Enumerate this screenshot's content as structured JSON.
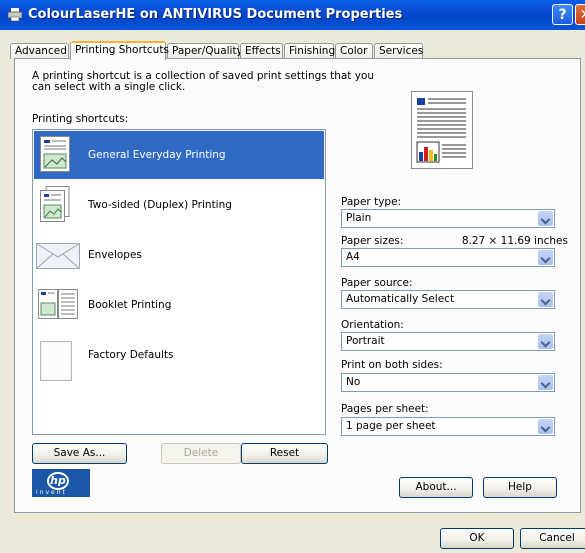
{
  "window": {
    "title": "ColourLaserHE on ANTIVIRUS Document Properties",
    "help_label": "?",
    "close_label": "✕"
  },
  "tabs": [
    {
      "label": "Advanced",
      "active": false
    },
    {
      "label": "Printing Shortcuts",
      "active": true
    },
    {
      "label": "Paper/Quality",
      "active": false
    },
    {
      "label": "Effects",
      "active": false
    },
    {
      "label": "Finishing",
      "active": false
    },
    {
      "label": "Color",
      "active": false
    },
    {
      "label": "Services",
      "active": false
    }
  ],
  "intro_text": "A printing shortcut is a collection of saved print settings that you can select with a single click.",
  "shortcuts_label": "Printing shortcuts:",
  "shortcuts": [
    {
      "label": "General Everyday Printing",
      "icon": "general-printing-icon",
      "selected": true
    },
    {
      "label": "Two-sided (Duplex) Printing",
      "icon": "duplex-printing-icon",
      "selected": false
    },
    {
      "label": "Envelopes",
      "icon": "envelope-icon",
      "selected": false
    },
    {
      "label": "Booklet Printing",
      "icon": "booklet-icon",
      "selected": false
    },
    {
      "label": "Factory Defaults",
      "icon": "factory-defaults-icon",
      "selected": false
    }
  ],
  "list_buttons": {
    "save_as": "Save As...",
    "delete": "Delete",
    "reset": "Reset"
  },
  "fields": {
    "paper_type": {
      "label": "Paper type:",
      "value": "Plain"
    },
    "paper_sizes": {
      "label": "Paper sizes:",
      "dimensions": "8.27 × 11.69 inches",
      "value": "A4"
    },
    "paper_source": {
      "label": "Paper source:",
      "value": "Automatically Select"
    },
    "orientation": {
      "label": "Orientation:",
      "value": "Portrait"
    },
    "print_both_sides": {
      "label": "Print on both sides:",
      "value": "No"
    },
    "pages_per_sheet": {
      "label": "Pages per sheet:",
      "value": "1 page per sheet"
    }
  },
  "logo": {
    "brand": "hp",
    "tagline": "invent"
  },
  "panel_buttons": {
    "about": "About...",
    "help": "Help"
  },
  "dialog_buttons": {
    "ok": "OK",
    "cancel": "Cancel"
  },
  "colors": {
    "selection": "#316ac5",
    "titlebar": "#0a4bd0",
    "dialog_bg": "#ece9d8"
  }
}
